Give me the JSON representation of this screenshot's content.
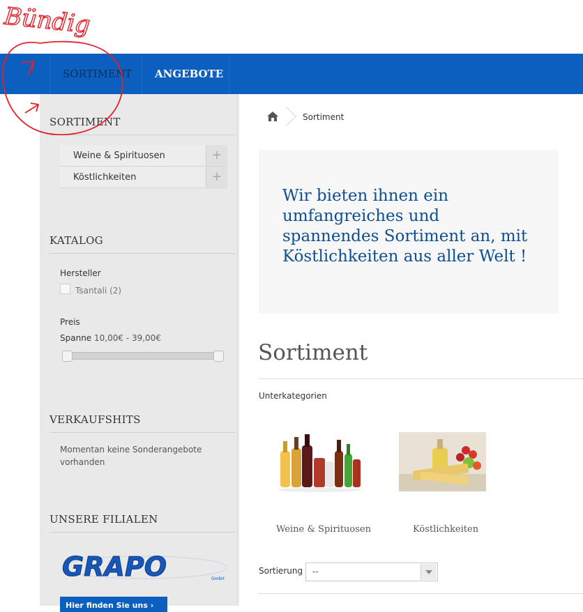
{
  "annotation": {
    "text": "Bündig"
  },
  "nav": {
    "items": [
      "SORTIMENT",
      "ANGEBOTE"
    ]
  },
  "sidebar": {
    "sortiment_heading": "SORTIMENT",
    "categories": [
      {
        "label": "Weine & Spirituosen",
        "expand": "+"
      },
      {
        "label": "Köstlichkeiten",
        "expand": "+"
      }
    ],
    "katalog_heading": "KATALOG",
    "hersteller_label": "Hersteller",
    "hersteller_option": "Tsantali (2)",
    "preis_label": "Preis",
    "spanne_label": "Spanne",
    "spanne_value": "10,00€ - 39,00€",
    "price_range": {
      "min": 10,
      "max": 39,
      "selected_min": 10,
      "selected_max": 39
    },
    "verkaufshits_heading": "VERKAUFSHITS",
    "verkaufshits_text": "Momentan keine Sonderangebote vorhanden",
    "filialen_heading": "UNSERE FILIALEN",
    "logo_text": "GRAPO",
    "logo_sub": "GmbH",
    "filialen_button": "Hier finden Sie uns"
  },
  "breadcrumb": {
    "current": "Sortiment"
  },
  "main": {
    "intro": "Wir bieten ihnen ein umfangreiches und spannendes Sortiment an, mit Köstlichkeiten aus aller Welt !",
    "title": "Sortiment",
    "subcategories_label": "Unterkategorien",
    "subcategories": [
      "Weine & Spirituosen",
      "Köstlichkeiten"
    ],
    "sort_label": "Sortierung",
    "sort_value": "--"
  },
  "colors": {
    "nav_blue": "#0a5fbf",
    "intro_text": "#0e4f94",
    "annotation_red": "#e8202a"
  }
}
